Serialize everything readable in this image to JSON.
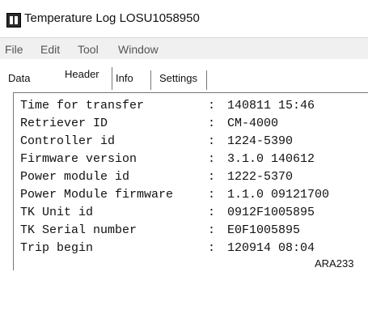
{
  "window": {
    "title": "Temperature Log LOSU1058950",
    "icon": "app-logo-icon"
  },
  "menu": {
    "items": [
      {
        "label": "File"
      },
      {
        "label": "Edit"
      },
      {
        "label": "Tool"
      },
      {
        "label": "Window"
      }
    ]
  },
  "tabs": {
    "items": [
      {
        "label": "Data"
      },
      {
        "label": "Header"
      },
      {
        "label": "Info"
      },
      {
        "label": "Settings"
      }
    ],
    "active": "Header"
  },
  "header": {
    "rows": [
      {
        "label": "Time for transfer",
        "value": "140811 15:46"
      },
      {
        "label": "Retriever ID",
        "value": "CM-4000"
      },
      {
        "label": "Controller id",
        "value": "1224-5390"
      },
      {
        "label": "Firmware version",
        "value": "3.1.0 140612"
      },
      {
        "label": "Power module id",
        "value": "1222-5370"
      },
      {
        "label": "Power Module firmware",
        "value": "1.1.0 09121700"
      },
      {
        "label": "TK Unit id",
        "value": "0912F1005895"
      },
      {
        "label": "TK Serial number",
        "value": "E0F1005895"
      },
      {
        "label": "Trip begin",
        "value": "120914 08:04"
      }
    ]
  },
  "figure_id": "ARA233"
}
